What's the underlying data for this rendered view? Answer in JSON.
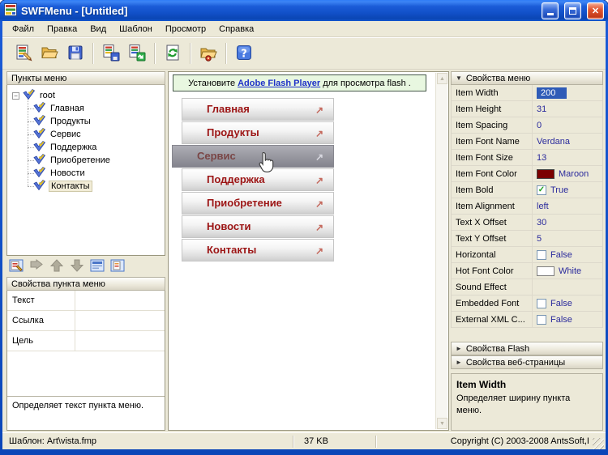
{
  "window": {
    "title": "SWFMenu - [Untitled]"
  },
  "menu_bar": {
    "items": [
      "Файл",
      "Правка",
      "Вид",
      "Шаблон",
      "Просмотр",
      "Справка"
    ]
  },
  "toolbar": {
    "groups": [
      [
        "new-template",
        "open",
        "save"
      ],
      [
        "export-template",
        "export-swf"
      ],
      [
        "refresh-preview"
      ],
      [
        "publish"
      ],
      [
        "help"
      ]
    ]
  },
  "left": {
    "tree_header": "Пункты меню",
    "tree": {
      "root": "root",
      "children": [
        "Главная",
        "Продукты",
        "Сервис",
        "Поддержка",
        "Приобретение",
        "Новости",
        "Контакты"
      ],
      "selected": "Контакты"
    },
    "tree_toolbar": [
      {
        "icon": "add-item",
        "disabled": false
      },
      {
        "icon": "add-subitem",
        "disabled": true
      },
      {
        "icon": "move-up",
        "disabled": true
      },
      {
        "icon": "move-down",
        "disabled": true
      },
      {
        "icon": "item-properties",
        "disabled": false
      },
      {
        "icon": "delete-item",
        "disabled": false
      }
    ],
    "item_props_header": "Свойства пункта меню",
    "item_props": [
      {
        "label": "Текст",
        "value": ""
      },
      {
        "label": "Ссылка",
        "value": ""
      },
      {
        "label": "Цель",
        "value": ""
      }
    ],
    "item_desc": "Определяет текст пункта меню."
  },
  "preview": {
    "notice": {
      "prefix": "Установите",
      "link": "Adobe Flash Player",
      "suffix": "для просмотра flash ."
    },
    "items": [
      "Главная",
      "Продукты",
      "Сервис",
      "Поддержка",
      "Приобретение",
      "Новости",
      "Контакты"
    ],
    "hover_item": "Сервис",
    "arrow_glyph": "↗"
  },
  "right": {
    "menu_section_header": "Свойства меню",
    "flash_section_header": "Свойства Flash",
    "web_section_header": "Свойства веб-страницы",
    "props": [
      {
        "label": "Item Width",
        "value": "200",
        "selected": true
      },
      {
        "label": "Item Height",
        "value": "31"
      },
      {
        "label": "Item Spacing",
        "value": "0"
      },
      {
        "label": "Item Font Name",
        "value": "Verdana"
      },
      {
        "label": "Item Font Size",
        "value": "13"
      },
      {
        "label": "Item Font Color",
        "value": "Maroon",
        "swatch": "#7b0000"
      },
      {
        "label": "Item Bold",
        "value": "True",
        "checkbox": true,
        "checked": true
      },
      {
        "label": "Item Alignment",
        "value": "left"
      },
      {
        "label": "Text X Offset",
        "value": "30"
      },
      {
        "label": "Text Y Offset",
        "value": "5"
      },
      {
        "label": "Horizontal",
        "value": "False",
        "checkbox": true,
        "checked": false
      },
      {
        "label": "Hot Font Color",
        "value": "White",
        "swatch": "#ffffff"
      },
      {
        "label": "Sound Effect",
        "value": ""
      },
      {
        "label": "Embedded Font",
        "value": "False",
        "checkbox": true,
        "checked": false
      },
      {
        "label": "External XML C...",
        "value": "False",
        "checkbox": true,
        "checked": false
      }
    ],
    "description": {
      "title": "Item Width",
      "text": "Определяет ширину пункта меню."
    }
  },
  "status_bar": {
    "template": "Шаблон:  Art\\vista.fmp",
    "size": "37 KB",
    "copyright": "Copyright (C) 2003-2008 AntsSoft,I"
  },
  "colors": {
    "accent_selection": "#316AC5",
    "menu_item_text": "#9c1414",
    "maroon_swatch": "#7b0000",
    "notice_bg": "#e8f7e0",
    "face": "#ECE9D8"
  }
}
